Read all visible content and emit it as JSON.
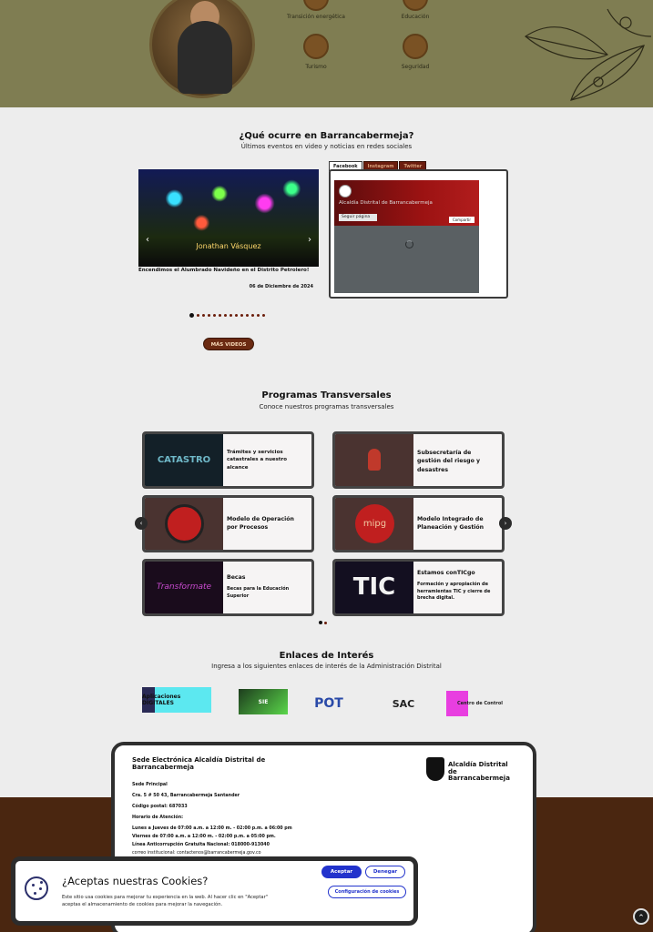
{
  "hero": {
    "items": [
      {
        "label": "Transición energética",
        "icon": "energy-icon"
      },
      {
        "label": "Educación",
        "icon": "education-icon"
      },
      {
        "label": "Turismo",
        "icon": "tourism-icon"
      },
      {
        "label": "Seguridad",
        "icon": "security-icon"
      }
    ]
  },
  "events": {
    "title": "¿Qué ocurre en Barrancabermeja?",
    "subtitle": "Últimos eventos en video y noticias en redes sociales",
    "video_overlay": "Jonathan Vásquez",
    "video_caption": "Encendimos el Alumbrado Navideño en el Distrito Petrolero!",
    "video_date": "06 de Diciembre de 2024",
    "more_button": "MÁS VIDEOS",
    "social_tabs": [
      "Facebook",
      "Instagram",
      "Twitter"
    ],
    "fb_page_name": "Alcaldía Distrital de Barrancabermeja",
    "fb_follow": "Seguir página",
    "fb_share": "Compartir"
  },
  "programs": {
    "title": "Programas Transversales",
    "subtitle": "Conoce nuestros programas transversales",
    "cards": [
      {
        "title": "Trámites y servicios catastrales a nuestro alcance",
        "desc": "",
        "thumb_text": "CATASTRO"
      },
      {
        "title": "Subsecretaría de gestión del riesgo y desastres",
        "desc": "",
        "thumb_text": ""
      },
      {
        "title": "Modelo de Operación por Procesos",
        "desc": "",
        "thumb_text": ""
      },
      {
        "title": "Modelo Integrado de Planeación y Gestión",
        "desc": "",
        "thumb_text": "mipg"
      },
      {
        "title": "Becas",
        "desc": "Becas para la Educación Superior",
        "thumb_text": "Transformate"
      },
      {
        "title": "Estamos conTICgo",
        "desc": "Formación y apropiación de herramientas TIC y cierre de brecha digital.",
        "thumb_text": "TIC"
      }
    ]
  },
  "links": {
    "title": "Enlaces de Interés",
    "subtitle": "Ingresa a los siguientes enlaces de interés de la Administración Distrital",
    "items": [
      "Aplicaciones DIGITALES",
      "SIE",
      "POT",
      "SAC",
      "Centro de Control"
    ]
  },
  "footer": {
    "title": "Sede Electrónica Alcaldía Distrital de Barrancabermeja",
    "logo_name": "Alcaldía Distrital de Barrancabermeja",
    "lines": [
      "Sede Principal",
      "Cra. 5 # 50 43, Barrancabermeja Santander",
      "Código postal: 687033",
      "Horario de Atención:",
      "Lunes a Jueves de 07:00 a.m. a 12:00 m. - 02:00 p.m. a 06:00 pm",
      "Viernes de 07:00 a.m. a 12:00 m. - 02:00 p.m. a 05:00 pm.",
      "Línea Anticorrupción Gratuita Nacional: 018000-913040",
      "correo institucional: contactenos@barrancabermeja.gov.co"
    ]
  },
  "cookies": {
    "title": "¿Aceptas nuestras Cookies?",
    "text": "Este sitio usa cookies para mejorar tu experiencia en la web. Al hacer clic en \"Aceptar\" aceptas el almacenamiento de cookies para mejorar la navegación.",
    "accept": "Aceptar",
    "deny": "Denegar",
    "config": "Configuración de cookies"
  },
  "colors": {
    "hero_bg": "#7f7d52",
    "brand_brown": "#4a2610",
    "accent_red": "#6b1d0e",
    "cookie_blue": "#2233cc"
  }
}
